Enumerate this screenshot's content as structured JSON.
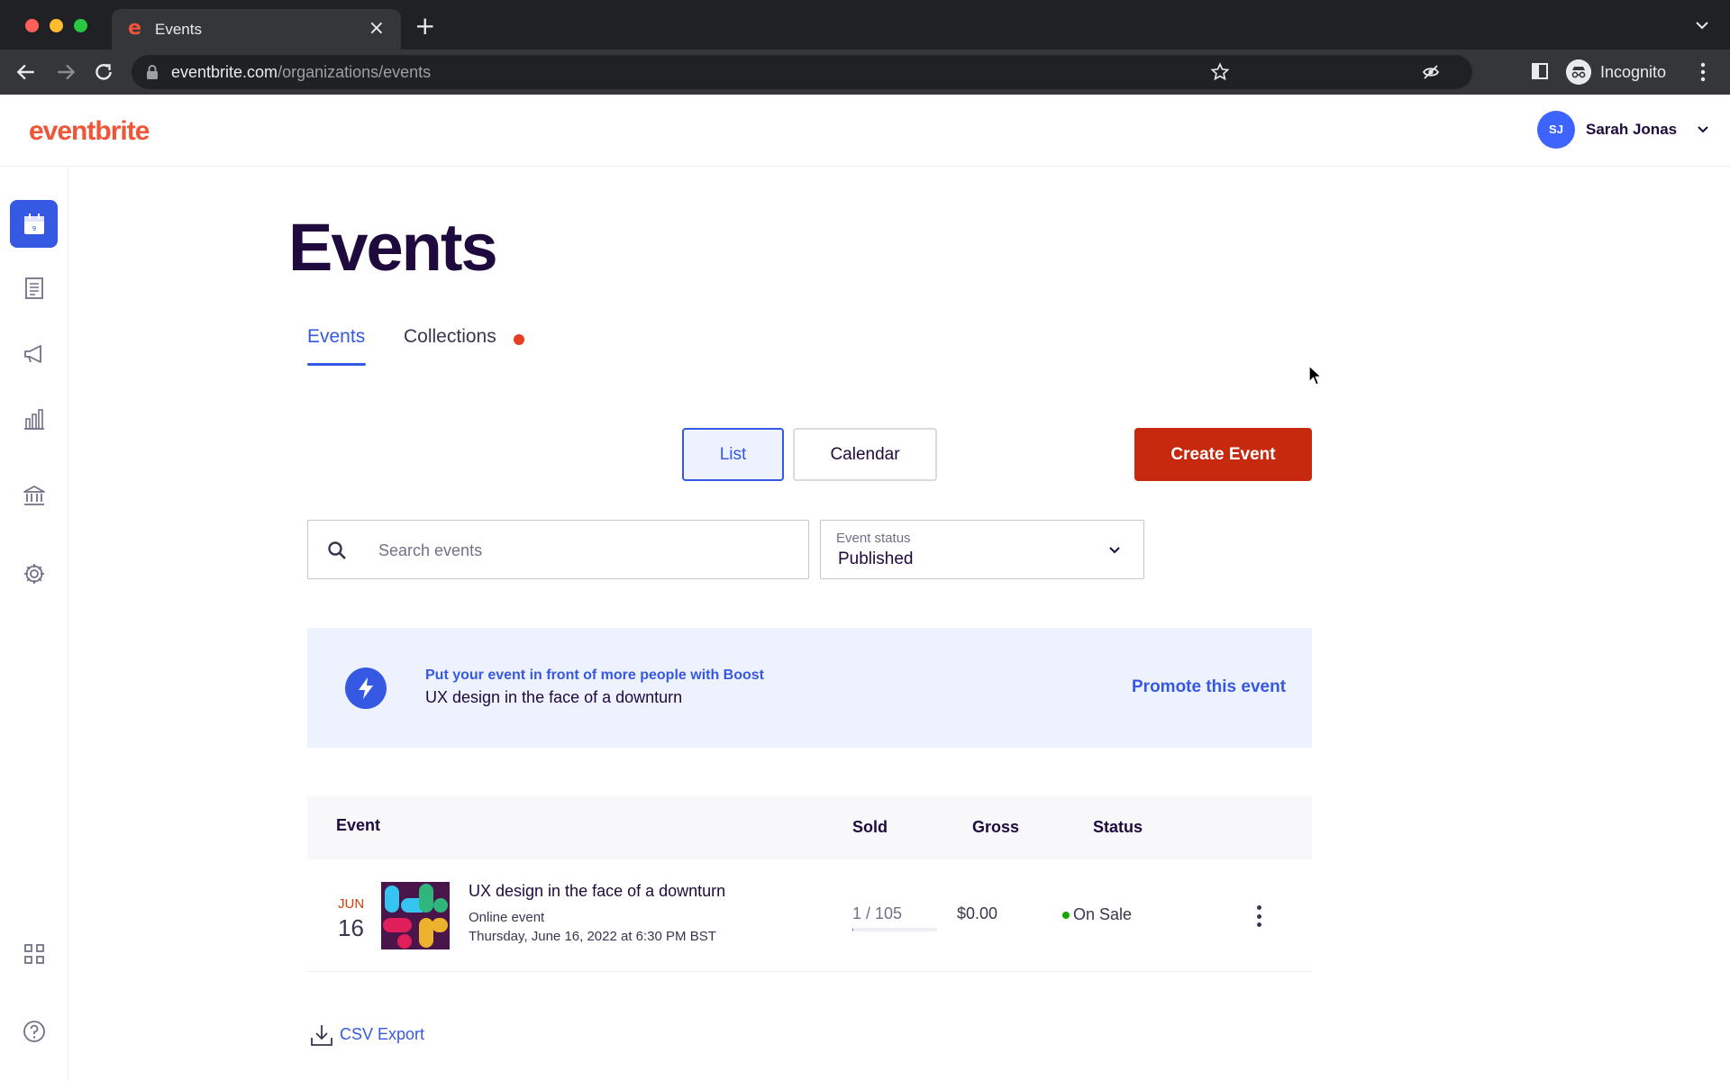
{
  "browser": {
    "tab_title": "Events",
    "favicon": "e",
    "url_host": "eventbrite.com",
    "url_path": "/organizations/events",
    "profile_label": "Incognito"
  },
  "header": {
    "logo": "eventbrite",
    "user_initials": "SJ",
    "user_name": "Sarah Jonas"
  },
  "sidebar": {
    "items": [
      {
        "icon": "calendar-icon",
        "active": true
      },
      {
        "icon": "orders-icon"
      },
      {
        "icon": "megaphone-icon"
      },
      {
        "icon": "bar-chart-icon"
      },
      {
        "icon": "finance-bank-icon"
      },
      {
        "icon": "gear-icon"
      },
      {
        "icon": "app-grid-icon"
      },
      {
        "icon": "help-icon"
      }
    ]
  },
  "main": {
    "title": "Events",
    "tabs": [
      {
        "label": "Events",
        "active": true
      },
      {
        "label": "Collections",
        "notification": true
      }
    ],
    "view_toggle": {
      "list": "List",
      "calendar": "Calendar",
      "selected": "List"
    },
    "create_button": "Create Event",
    "search": {
      "placeholder": "Search events",
      "value": ""
    },
    "status_filter": {
      "label": "Event status",
      "value": "Published"
    },
    "boost": {
      "kicker": "Put your event in front of more people with Boost",
      "event_name": "UX design in the face of a downturn",
      "link": "Promote this event"
    },
    "table": {
      "columns": [
        "Event",
        "Sold",
        "Gross",
        "Status"
      ],
      "rows": [
        {
          "month": "JUN",
          "day": "16",
          "title": "UX design in the face of a downturn",
          "type": "Online event",
          "datetime": "Thursday, June 16, 2022 at 6:30 PM BST",
          "sold": "1 / 105",
          "sold_fraction": 0.0095,
          "gross": "$0.00",
          "status": "On Sale"
        }
      ]
    },
    "csv_export": "CSV Export"
  },
  "colors": {
    "brand": "#f05537",
    "primary": "#3659e3",
    "create_button": "#c6290e",
    "on_sale": "#14a800"
  }
}
